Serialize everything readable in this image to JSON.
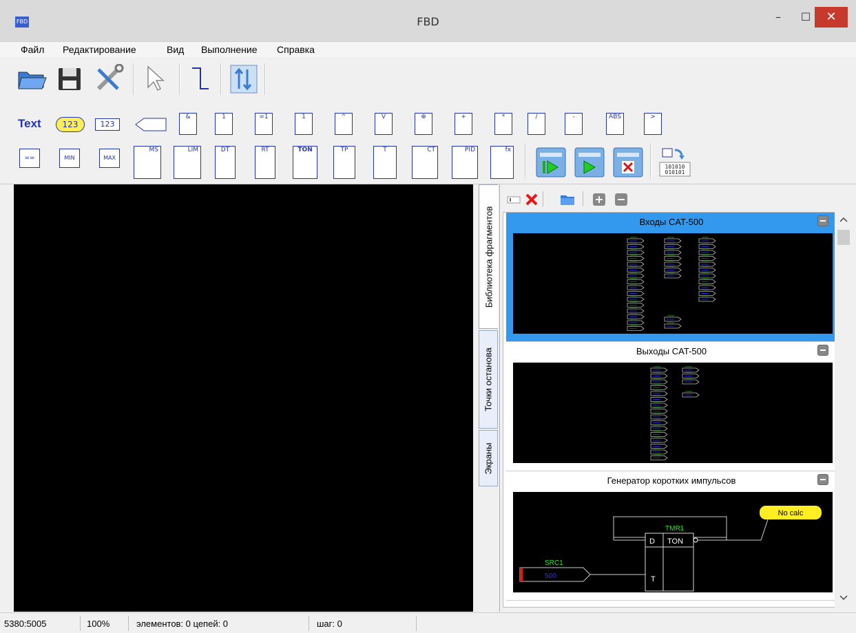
{
  "window": {
    "title": "FBD",
    "icon_label": "FBD",
    "minimize": "–",
    "maximize": "☐",
    "close": "✕"
  },
  "menu": [
    "Файл",
    "Редактирование",
    "Вид",
    "Выполнение",
    "Справка"
  ],
  "toolbar1": {
    "icons": [
      "open-icon",
      "save-icon",
      "tools-icon",
      "pointer-icon",
      "wire-icon",
      "compile-icon"
    ]
  },
  "toolbar2": {
    "row1": [
      "Text",
      "123",
      "123",
      "",
      "&",
      "1",
      "=1",
      "1",
      "^",
      "V",
      "⊕",
      "+",
      "*",
      "/",
      "-",
      "ABS",
      ">"
    ],
    "row2": [
      "==",
      "MIN",
      "MAX",
      "MS",
      "LIM",
      "DT",
      "RT",
      "TON",
      "TP",
      "T",
      "CT",
      "PID",
      "fx",
      "",
      "",
      "",
      "101010"
    ]
  },
  "vtabs": [
    "Библиотека фрагментов",
    "Точки останова",
    "Экраны"
  ],
  "fragments": [
    {
      "title": "Входы CAT-500"
    },
    {
      "title": "Выходы CAT-500"
    },
    {
      "title": "Генератор коротких импульсов",
      "labels": {
        "src": "SRC1",
        "src_val": "500",
        "tmr": "TMR1",
        "ton": "TON",
        "d": "D",
        "t": "T",
        "no_calc": "No calc"
      }
    }
  ],
  "status": {
    "coords": "5380:5005",
    "zoom": "100%",
    "counts": "элементов: 0 цепей: 0",
    "step": "шаг: 0"
  }
}
